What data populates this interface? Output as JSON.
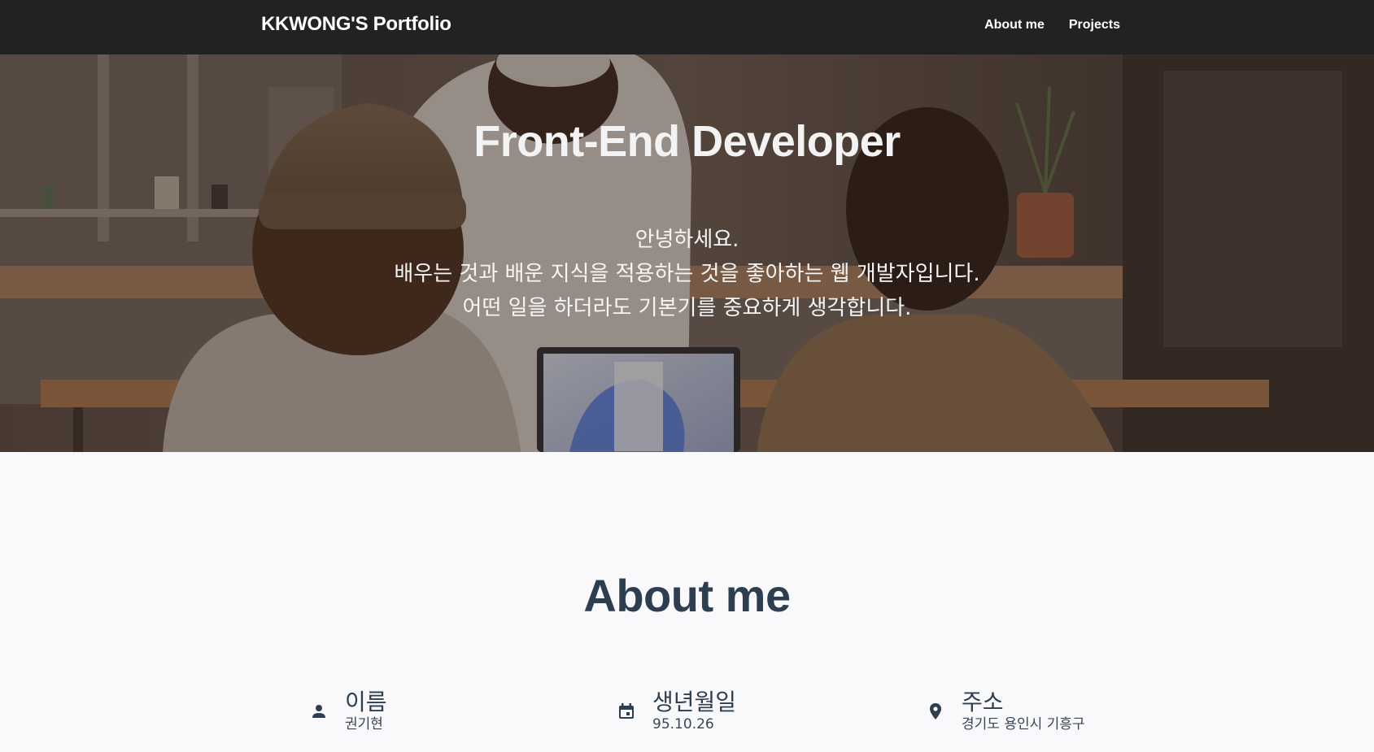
{
  "navbar": {
    "brand": "KKWONG'S Portfolio",
    "links": [
      "About me",
      "Projects"
    ],
    "background": "#222222"
  },
  "hero": {
    "title": "Front-End Developer",
    "lines": [
      "안녕하세요.",
      "배우는 것과 배운 지식을 적용하는 것을 좋아하는 웹 개발자입니다.",
      "어떤 일을 하더라도 기본기를 중요하게 생각합니다."
    ]
  },
  "about": {
    "title": "About me",
    "items": [
      {
        "icon": "person-icon",
        "label": "이름",
        "value": "권기현"
      },
      {
        "icon": "calendar-icon",
        "label": "생년월일",
        "value": "95.10.26"
      },
      {
        "icon": "location-pin-icon",
        "label": "주소",
        "value": "경기도 용인시 기흥구"
      }
    ]
  },
  "colors": {
    "heading": "#2c3e50",
    "page_background": "#f9f9fb"
  }
}
